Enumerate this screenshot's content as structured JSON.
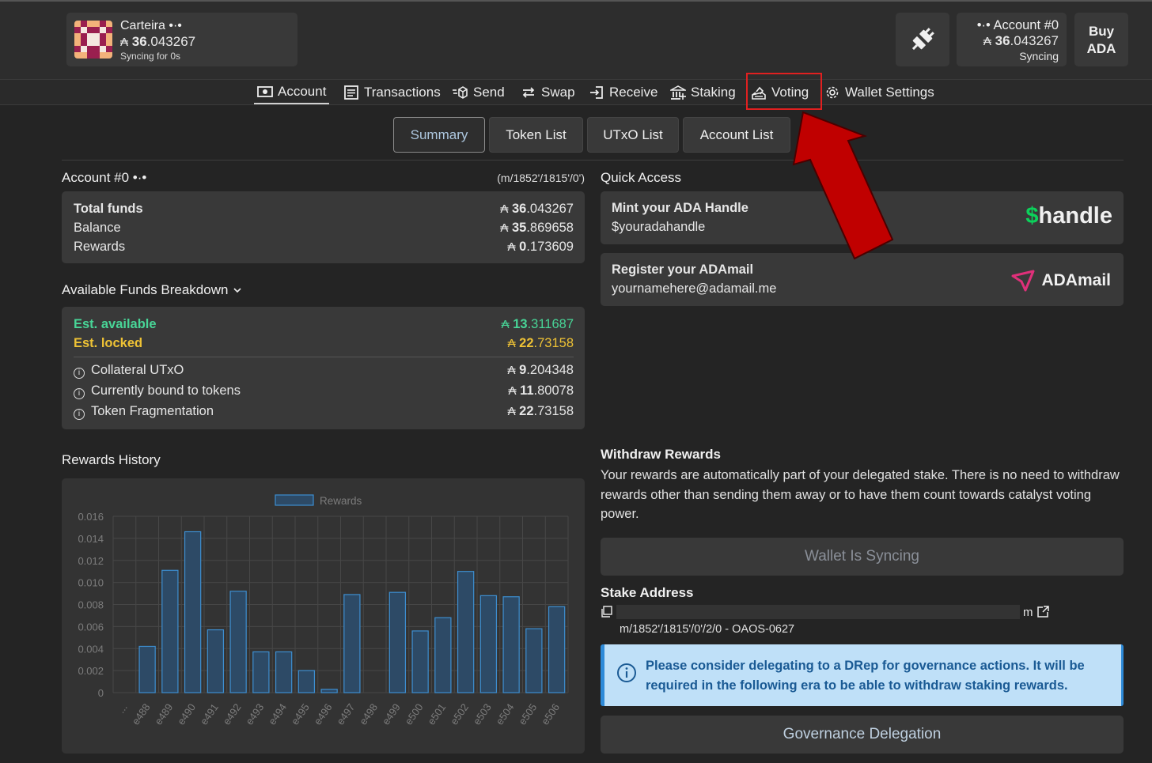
{
  "wallet": {
    "name": "Carteira",
    "dots": "•·•",
    "currency_symbol": "₳",
    "balance_int": "36",
    "balance_dec": ".043267",
    "sync_status": "Syncing for 0s"
  },
  "header_account": {
    "dots": "•·•",
    "label": "Account #0",
    "balance_int": "36",
    "balance_dec": ".043267",
    "status": "Syncing"
  },
  "buy": {
    "line1": "Buy",
    "line2": "ADA"
  },
  "nav": [
    {
      "label": "Account",
      "icon": "account-icon",
      "active": true
    },
    {
      "label": "Transactions",
      "icon": "transactions-icon"
    },
    {
      "label": "Send",
      "icon": "send-icon"
    },
    {
      "label": "Swap",
      "icon": "swap-icon"
    },
    {
      "label": "Receive",
      "icon": "receive-icon"
    },
    {
      "label": "Staking",
      "icon": "staking-icon"
    },
    {
      "label": "Voting",
      "icon": "voting-icon",
      "highlighted": true
    },
    {
      "label": "Wallet Settings",
      "icon": "gear-icon"
    }
  ],
  "tabs": [
    {
      "label": "Summary",
      "selected": true
    },
    {
      "label": "Token List"
    },
    {
      "label": "UTxO List"
    },
    {
      "label": "Account List"
    }
  ],
  "account": {
    "title": "Account #0 •·•",
    "path": "(m/1852'/1815'/0')",
    "total_funds_label": "Total funds",
    "total_funds_int": "36",
    "total_funds_dec": ".043267",
    "balance_label": "Balance",
    "balance_int": "35",
    "balance_dec": ".869658",
    "rewards_label": "Rewards",
    "rewards_int": "0",
    "rewards_dec": ".173609"
  },
  "breakdown": {
    "title": "Available Funds Breakdown",
    "est_available_label": "Est. available",
    "est_available_int": "13",
    "est_available_dec": ".311687",
    "est_locked_label": "Est. locked",
    "est_locked_int": "22",
    "est_locked_dec": ".73158",
    "items": [
      {
        "label": "Collateral UTxO",
        "int": "9",
        "dec": ".204348"
      },
      {
        "label": "Currently bound to tokens",
        "int": "11",
        "dec": ".80078"
      },
      {
        "label": "Token Fragmentation",
        "int": "22",
        "dec": ".73158"
      }
    ]
  },
  "quick_access": {
    "title": "Quick Access",
    "handle": {
      "title": "Mint your ADA Handle",
      "subtitle": "$youradahandle",
      "logo_symbol": "$",
      "logo_text": "handle"
    },
    "adamail": {
      "title": "Register your ADAmail",
      "subtitle": "yournamehere@adamail.me",
      "logo_text": "ADAmail"
    }
  },
  "rewards_history": {
    "title": "Rewards History"
  },
  "withdraw": {
    "title": "Withdraw Rewards",
    "text": "Your rewards are automatically part of your delegated stake. There is no need to withdraw rewards other than sending them away or to have them count towards catalyst voting power.",
    "button": "Wallet Is Syncing"
  },
  "stake": {
    "title": "Stake Address",
    "address_tail": "m",
    "path": "m/1852'/1815'/0'/2/0 - OAOS-0627"
  },
  "notice": {
    "text": "Please consider delegating to a DRep for governance actions. It will be required in the following era to be able to withdraw staking rewards."
  },
  "governance_button": "Governance Delegation",
  "colors": {
    "bar_fill": "#2d4a66",
    "bar_stroke": "#3d8ed0",
    "green": "#48d597",
    "gold": "#eec235",
    "arrow_red": "#c00000",
    "notice_bg": "#bfe0f8"
  },
  "chart_data": {
    "type": "bar",
    "title": "",
    "legend": [
      "Rewards"
    ],
    "legend_position": "top",
    "categories": [
      "...",
      "e488",
      "e489",
      "e490",
      "e491",
      "e492",
      "e493",
      "e494",
      "e495",
      "e496",
      "e497",
      "e498",
      "e499",
      "e500",
      "e501",
      "e502",
      "e503",
      "e504",
      "e505",
      "e506"
    ],
    "series": [
      {
        "name": "Rewards",
        "values": [
          0,
          0.0042,
          0.0111,
          0.0146,
          0.0057,
          0.0092,
          0.0037,
          0.0037,
          0.002,
          0.0003,
          0.0089,
          0,
          0.0091,
          0.0056,
          0.0068,
          0.011,
          0.0088,
          0.0087,
          0.0058,
          0.0078
        ]
      }
    ],
    "yticks": [
      "0",
      "0.002",
      "0.004",
      "0.006",
      "0.008",
      "0.010",
      "0.012",
      "0.014",
      "0.016"
    ],
    "ylim": [
      0,
      0.016
    ],
    "grid": true
  }
}
